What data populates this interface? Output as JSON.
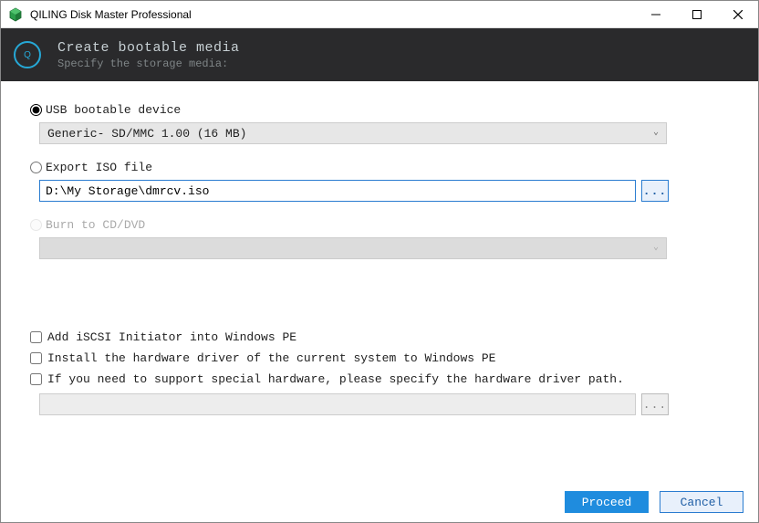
{
  "titlebar": {
    "title": "QILING Disk Master Professional"
  },
  "header": {
    "title": "Create bootable media",
    "subtitle": "Specify the storage media:"
  },
  "options": {
    "usb": {
      "label": "USB bootable device",
      "selected_device": "Generic- SD/MMC 1.00 (16 MB)",
      "checked": true
    },
    "iso": {
      "label": "Export ISO file",
      "path": "D:\\My Storage\\dmrcv.iso",
      "checked": false
    },
    "cd": {
      "label": "Burn to CD/DVD",
      "enabled": false
    }
  },
  "checks": {
    "iscsi": "Add iSCSI Initiator into Windows PE",
    "driver_current": "Install the hardware driver of the current system to Windows PE",
    "driver_path": "If you need to support special hardware, please specify the hardware driver path."
  },
  "buttons": {
    "browse": "...",
    "proceed": "Proceed",
    "cancel": "Cancel"
  }
}
